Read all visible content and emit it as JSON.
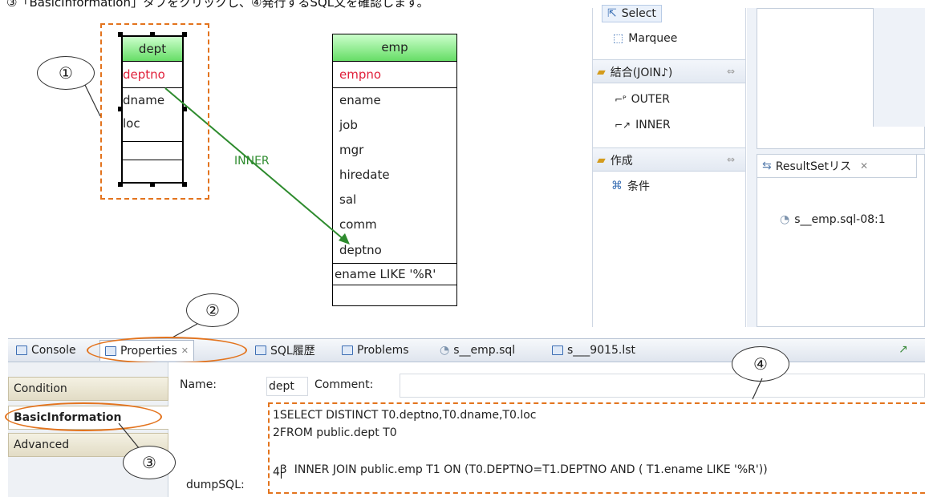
{
  "caption": "③「BasicInformation」タブをクリックし、④発行するSQL文を確認します。",
  "diagram": {
    "dept": {
      "title": "dept",
      "pk": "deptno",
      "cols": [
        "dname",
        "loc"
      ]
    },
    "emp": {
      "title": "emp",
      "pk": "empno",
      "cols": [
        "ename",
        "job",
        "mgr",
        "hiredate",
        "sal",
        "comm",
        "deptno"
      ],
      "condition": "ename LIKE '%R'"
    },
    "join_label": "INNER",
    "join_color": "#2e8b2e"
  },
  "palette": {
    "select": "Select",
    "marquee": "Marquee",
    "join_drawer": "結合(JOIN♪)",
    "outer": "OUTER",
    "inner": "INNER",
    "create_drawer": "作成",
    "condition": "条件"
  },
  "resultset": {
    "tab_label": "ResultSetリス",
    "item": "s__emp.sql-08:1"
  },
  "bottom_tabs": [
    "Console",
    "Properties",
    "SQL履歴",
    "Problems",
    "s__emp.sql",
    "s___9015.lst"
  ],
  "properties": {
    "side_tabs": [
      "Condition",
      "BasicInformation",
      "Advanced"
    ],
    "name_label": "Name:",
    "name_value": "dept",
    "comment_label": "Comment:",
    "dumpsql_label": "dumpSQL:",
    "sql_lines": [
      {
        "num": "1",
        "text": "SELECT DISTINCT T0.deptno,T0.dname,T0.loc"
      },
      {
        "num": "2",
        "text": "FROM public.dept T0"
      },
      {
        "num": "3",
        "text": "  INNER JOIN public.emp T1 ON (T0.DEPTNO=T1.DEPTNO AND ( T1.ename LIKE '%R'))"
      },
      {
        "num": "4",
        "text": ""
      }
    ]
  },
  "callouts": [
    "①",
    "②",
    "③",
    "④"
  ],
  "accent_orange": "#e3741e"
}
